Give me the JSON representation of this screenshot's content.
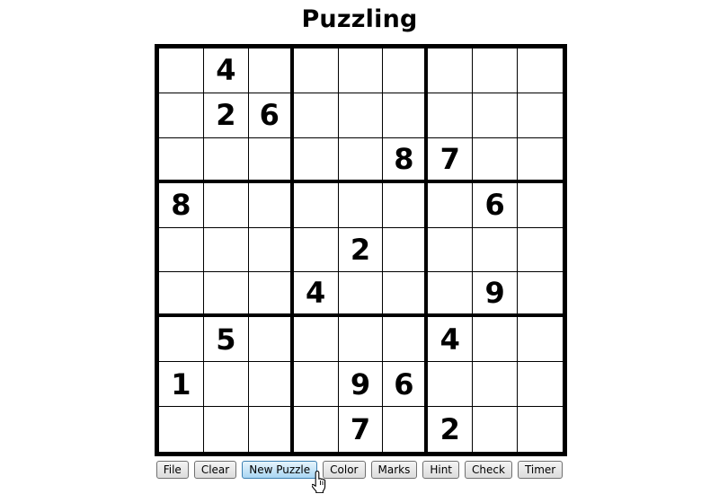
{
  "title": "Puzzling",
  "grid": [
    [
      "",
      "4",
      "",
      "",
      "",
      "",
      "",
      "",
      ""
    ],
    [
      "",
      "2",
      "6",
      "",
      "",
      "",
      "",
      "",
      ""
    ],
    [
      "",
      "",
      "",
      "",
      "",
      "8",
      "7",
      "",
      ""
    ],
    [
      "8",
      "",
      "",
      "",
      "",
      "",
      "",
      "6",
      ""
    ],
    [
      "",
      "",
      "",
      "",
      "2",
      "",
      "",
      "",
      ""
    ],
    [
      "",
      "",
      "",
      "4",
      "",
      "",
      "",
      "9",
      ""
    ],
    [
      "",
      "5",
      "",
      "",
      "",
      "",
      "4",
      "",
      ""
    ],
    [
      "1",
      "",
      "",
      "",
      "9",
      "6",
      "",
      "",
      ""
    ],
    [
      "",
      "",
      "",
      "",
      "7",
      "",
      "2",
      "",
      ""
    ]
  ],
  "toolbar": {
    "file": "File",
    "clear": "Clear",
    "new_puzzle": "New Puzzle",
    "color": "Color",
    "marks": "Marks",
    "hint": "Hint",
    "check": "Check",
    "timer": "Timer"
  },
  "colors": {
    "grid_line": "#000000",
    "active_button": "#a9d6f3"
  },
  "icons": {
    "cursor": "hand-pointer-icon"
  }
}
